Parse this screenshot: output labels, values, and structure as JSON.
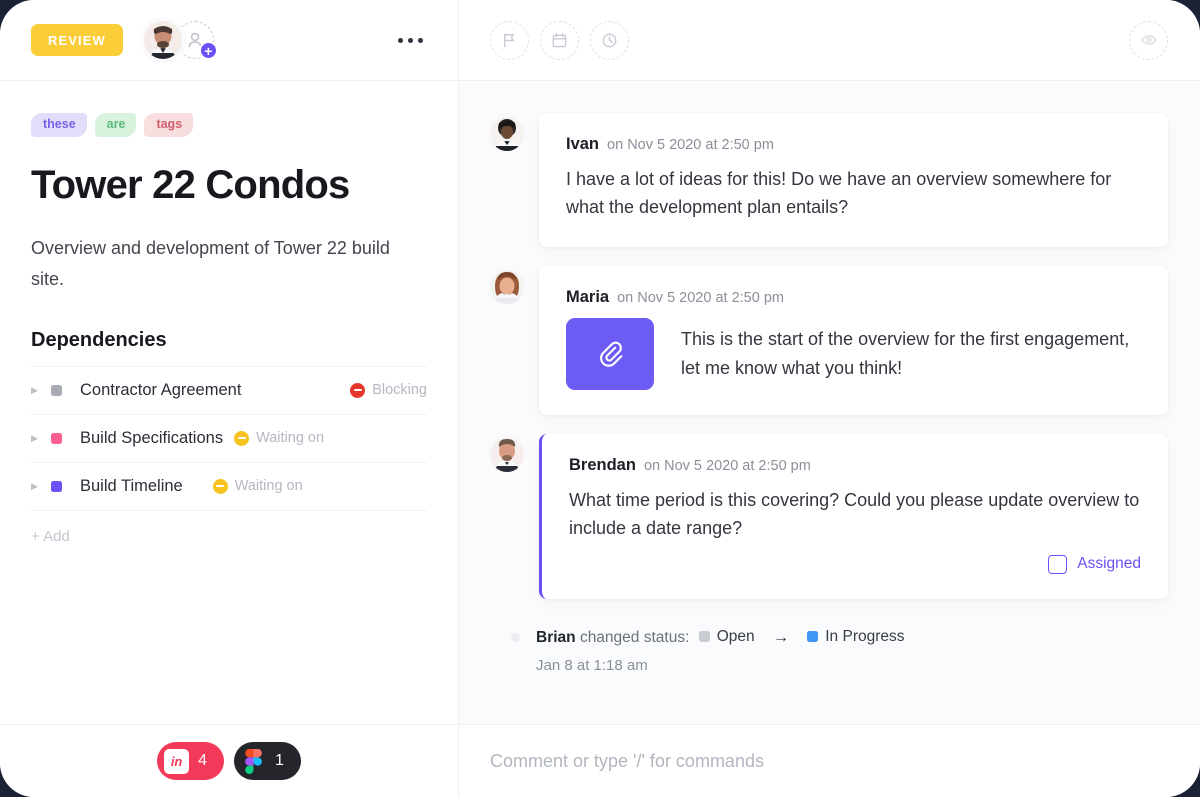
{
  "window": {
    "background_color": "#1b2233"
  },
  "left_panel": {
    "header": {
      "status_badge": "REVIEW",
      "status_badge_color": "#facd39",
      "assignee_avatar_name": "assignee-avatar",
      "add_assignee_label": "+",
      "more_menu_label": "..."
    },
    "tags": [
      {
        "label": "these",
        "bg": "#e2ddfb",
        "fg": "#7765e8"
      },
      {
        "label": "are",
        "bg": "#d8f2de",
        "fg": "#5cba76"
      },
      {
        "label": "tags",
        "bg": "#f8dedf",
        "fg": "#d0606c"
      }
    ],
    "title": "Tower 22 Condos",
    "description": "Overview and development of Tower 22 build site.",
    "dependencies_title": "Dependencies",
    "dependencies": [
      {
        "name": "Contractor Agreement",
        "swatch": "#a8abb4",
        "status": "Blocking",
        "status_color": "#e8352d",
        "align_right": true
      },
      {
        "name": "Build Specifications",
        "swatch": "#fa5f8f",
        "status": "Waiting on",
        "status_color": "#f7c321",
        "align_right": false
      },
      {
        "name": "Build Timeline",
        "swatch": "#6c4ff5",
        "status": "Waiting on",
        "status_color": "#f7c321",
        "align_right": false
      }
    ],
    "add_label": "+ Add",
    "integrations": [
      {
        "name": "invision-badge",
        "logo_text": "in",
        "count": "4",
        "color": "#f2395a"
      },
      {
        "name": "figma-badge",
        "logo_text": "",
        "count": "1",
        "color": "#24262c"
      }
    ]
  },
  "right_panel": {
    "toolbar": {
      "flag_label": "flag",
      "calendar_label": "calendar",
      "clock_label": "clock",
      "watch_label": "watch"
    },
    "comments": [
      {
        "author": "Ivan",
        "time": "on Nov 5 2020 at 2:50 pm",
        "body": "I have a lot of ideas for this! Do we have an overview somewhere for what the development plan entails?",
        "has_attachment": false,
        "assigned": false
      },
      {
        "author": "Maria",
        "time": "on Nov 5 2020 at 2:50 pm",
        "body": "This is the start of the overview for the first engagement, let me know what you think!",
        "has_attachment": true,
        "attachment_icon": "paperclip-icon",
        "assigned": false
      },
      {
        "author": "Brendan",
        "time": "on Nov 5 2020 at 2:50 pm",
        "body": "What time period is this covering? Could you please update overview to include a date range?",
        "has_attachment": false,
        "assigned": true,
        "assigned_label": "Assigned",
        "accent_color": "#6c4ff5"
      }
    ],
    "activity": {
      "author": "Brian",
      "action": "changed status:",
      "from_status": "Open",
      "from_color": "#c8cbd2",
      "to_status": "In Progress",
      "to_color": "#3f95f2",
      "arrow": "→",
      "time": "Jan 8 at 1:18 am"
    },
    "composer": {
      "placeholder": "Comment or type '/' for commands",
      "value": ""
    }
  }
}
